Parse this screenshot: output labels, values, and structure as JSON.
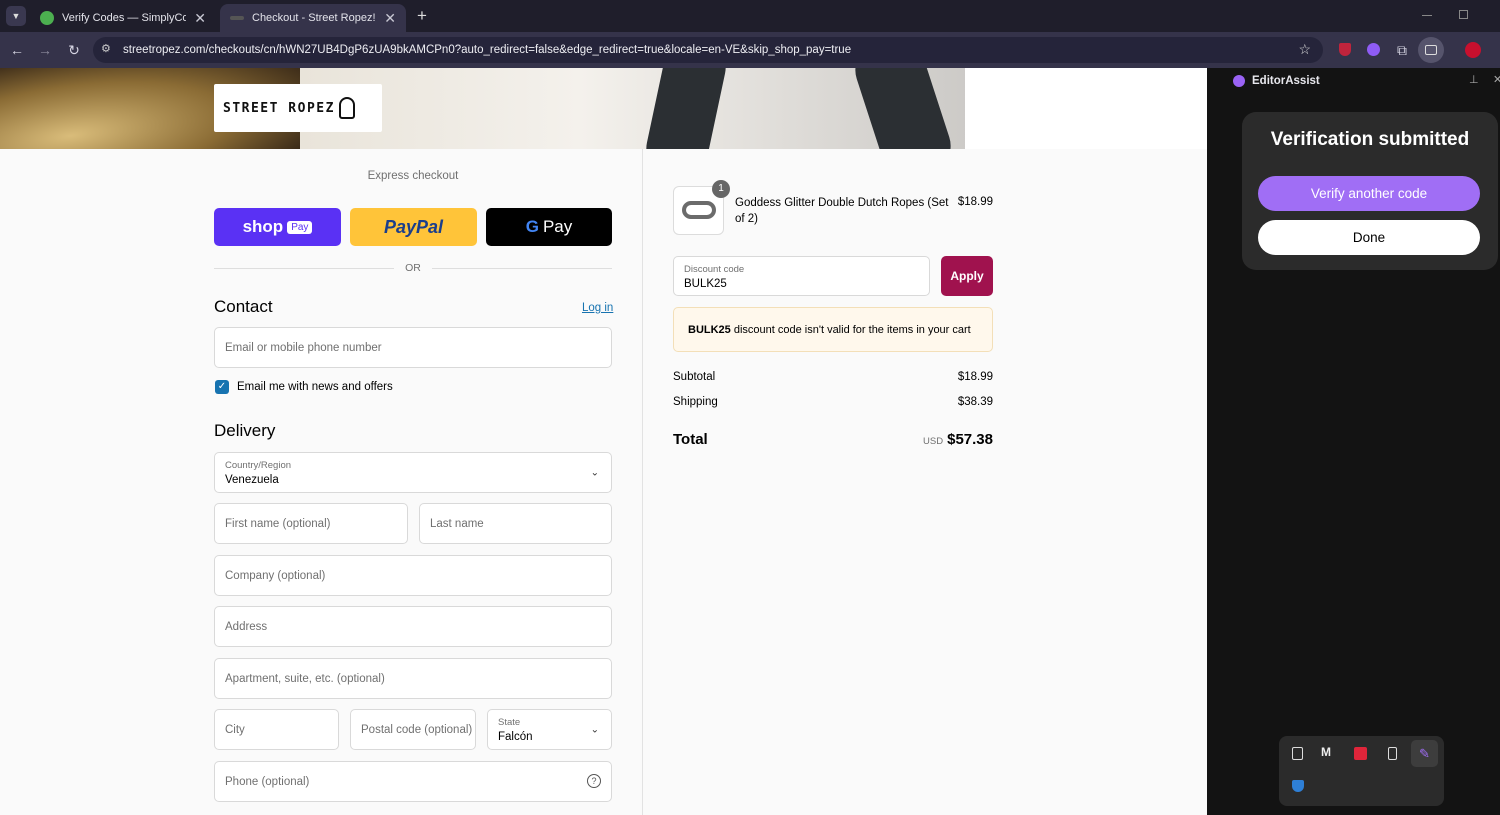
{
  "browser": {
    "tabs": [
      {
        "title": "Verify Codes — SimplyCodes",
        "close": "✕"
      },
      {
        "title": "Checkout - Street Ropez!",
        "close": "✕"
      }
    ],
    "new_tab": "+",
    "url": "streetropez.com/checkouts/cn/hWN27UB4DgP6zUA9bkAMCPn0?auto_redirect=false&edge_redirect=true&locale=en-VE&skip_shop_pay=true"
  },
  "store": {
    "logo_text": "STREET ROPEZ"
  },
  "express": {
    "heading": "Express checkout",
    "shop_label": "shop",
    "shop_pay": "Pay",
    "paypal_label": "PayPal",
    "gpay_label": "Pay",
    "or": "OR"
  },
  "contact": {
    "title": "Contact",
    "login": "Log in",
    "email_placeholder": "Email or mobile phone number",
    "newsletter": "Email me with news and offers"
  },
  "delivery": {
    "title": "Delivery",
    "country_label": "Country/Region",
    "country_value": "Venezuela",
    "first_name": "First name (optional)",
    "last_name": "Last name",
    "company": "Company (optional)",
    "address": "Address",
    "apartment": "Apartment, suite, etc. (optional)",
    "city": "City",
    "postal": "Postal code (optional)",
    "state_label": "State",
    "state_value": "Falcón",
    "phone": "Phone (optional)"
  },
  "summary": {
    "item": {
      "qty": "1",
      "name": "Goddess Glitter Double Dutch Ropes (Set of 2)",
      "price": "$18.99"
    },
    "discount_label": "Discount code",
    "discount_value": "BULK25",
    "apply": "Apply",
    "error_code": "BULK25",
    "error_text": " discount code isn't valid for the items in your cart",
    "subtotal_label": "Subtotal",
    "subtotal_value": "$18.99",
    "shipping_label": "Shipping",
    "shipping_value": "$38.39",
    "total_label": "Total",
    "currency": "USD",
    "total_value": "$57.38"
  },
  "sidepanel": {
    "title": "EditorAssist",
    "heading": "Verification submitted",
    "verify_another": "Verify another code",
    "done": "Done"
  },
  "colors": {
    "shop_purple": "#5a31f4",
    "paypal_yellow": "#ffc439",
    "apply_button": "#a0124e",
    "accent_purple": "#a06ef5",
    "error_bg": "#fff8ec"
  }
}
